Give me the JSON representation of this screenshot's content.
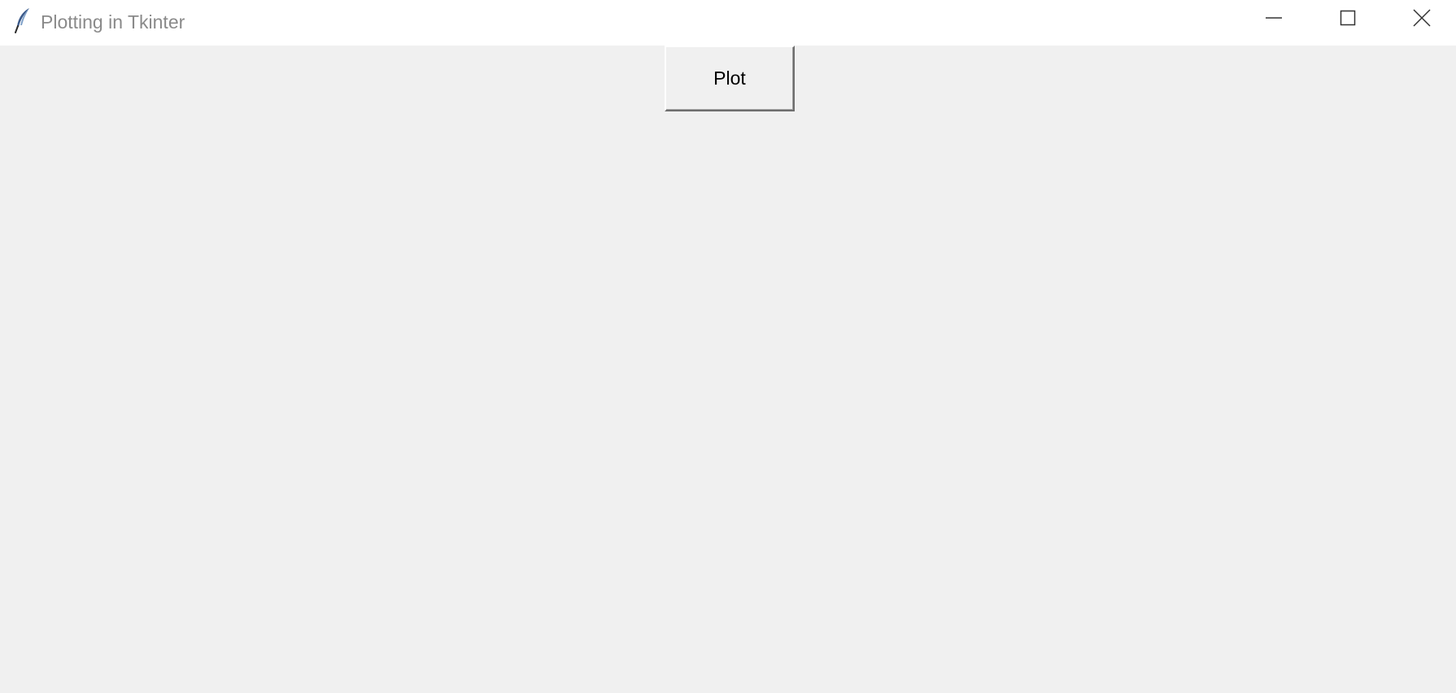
{
  "window": {
    "title": "Plotting in Tkinter",
    "app_icon": "tk-feather-icon",
    "controls": {
      "minimize_icon": "minimize-icon",
      "maximize_icon": "maximize-icon",
      "close_icon": "close-icon"
    }
  },
  "main": {
    "plot_button_label": "Plot"
  },
  "colors": {
    "titlebar_bg": "#ffffff",
    "client_bg": "#f0f0f0",
    "title_text": "#8a8a8a"
  }
}
